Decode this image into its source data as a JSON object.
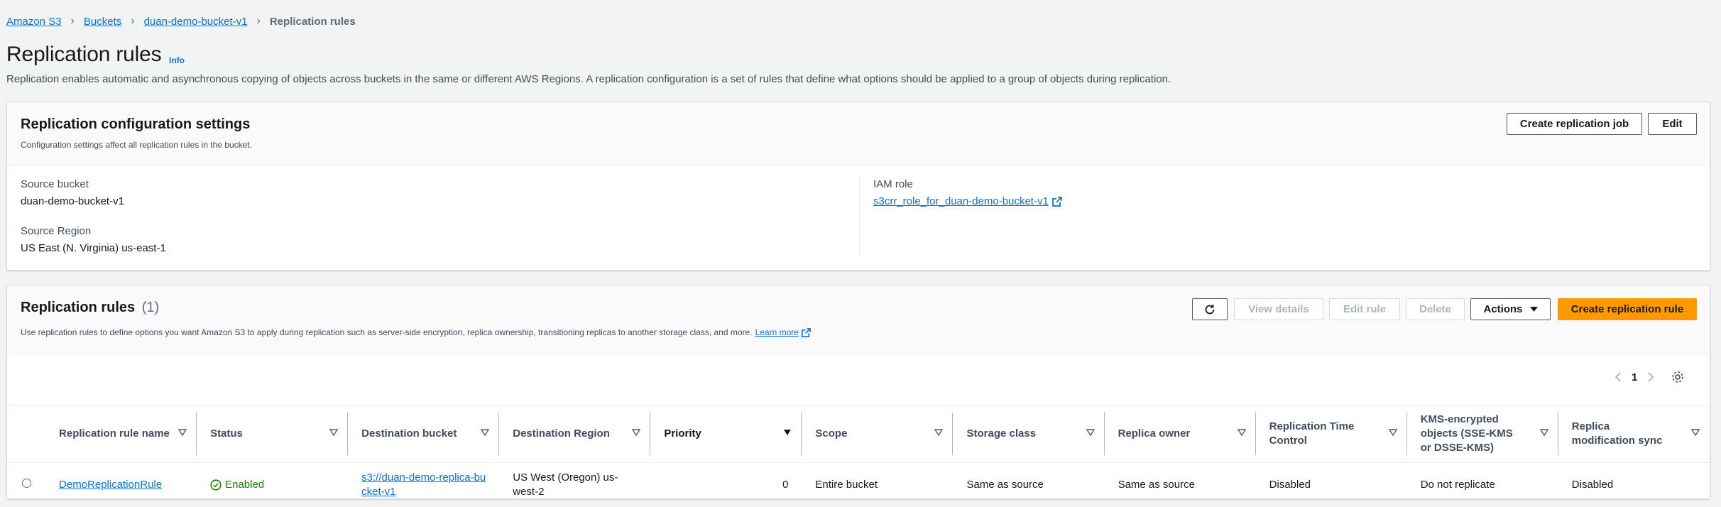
{
  "breadcrumb": {
    "items": [
      "Amazon S3",
      "Buckets",
      "duan-demo-bucket-v1"
    ],
    "current": "Replication rules"
  },
  "page": {
    "title": "Replication rules",
    "info_label": "Info",
    "description": "Replication enables automatic and asynchronous copying of objects across buckets in the same or different AWS Regions. A replication configuration is a set of rules that define what options should be applied to a group of objects during replication."
  },
  "config_panel": {
    "title": "Replication configuration settings",
    "subtitle": "Configuration settings affect all replication rules in the bucket.",
    "create_job_label": "Create replication job",
    "edit_label": "Edit",
    "source_bucket_label": "Source bucket",
    "source_bucket_value": "duan-demo-bucket-v1",
    "source_region_label": "Source Region",
    "source_region_value": "US East (N. Virginia) us-east-1",
    "iam_role_label": "IAM role",
    "iam_role_value": "s3crr_role_for_duan-demo-bucket-v1"
  },
  "rules_panel": {
    "title": "Replication rules",
    "count": "(1)",
    "description": "Use replication rules to define options you want Amazon S3 to apply during replication such as server-side encryption, replica ownership, transitioning replicas to another storage class, and more.",
    "learn_more": "Learn more",
    "buttons": {
      "view_details": "View details",
      "edit_rule": "Edit rule",
      "delete": "Delete",
      "actions": "Actions",
      "create_rule": "Create replication rule"
    },
    "page_number": "1",
    "columns": [
      "Replication rule name",
      "Status",
      "Destination bucket",
      "Destination Region",
      "Priority",
      "Scope",
      "Storage class",
      "Replica owner",
      "Replication Time Control",
      "KMS-encrypted objects (SSE-KMS or DSSE-KMS)",
      "Replica modification sync"
    ],
    "rows": [
      {
        "name": "DemoReplicationRule",
        "status": "Enabled",
        "destination_bucket": "s3://duan-demo-replica-bucket-v1",
        "destination_region": "US West (Oregon) us-west-2",
        "priority": "0",
        "scope": "Entire bucket",
        "storage_class": "Same as source",
        "replica_owner": "Same as source",
        "rtc": "Disabled",
        "kms": "Do not replicate",
        "replica_mod_sync": "Disabled"
      }
    ]
  },
  "colors": {
    "link": "#0972d3",
    "primary_button": "#ff9900",
    "success": "#1d8102",
    "background": "#f2f3f3"
  }
}
